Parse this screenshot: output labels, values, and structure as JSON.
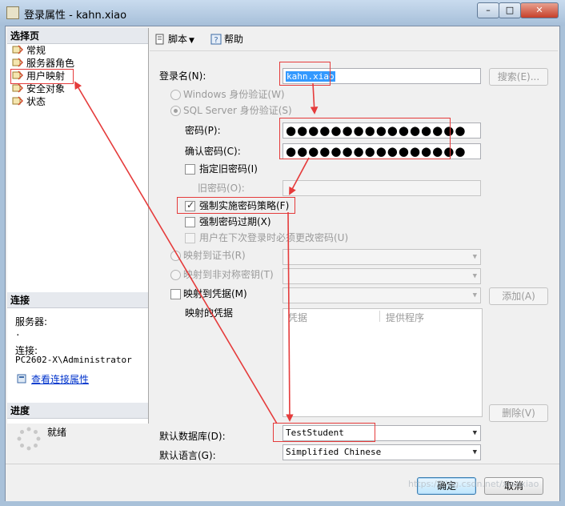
{
  "window": {
    "title": "登录属性 - kahn.xiao"
  },
  "left": {
    "pages_header": "选择页",
    "pages": [
      "常规",
      "服务器角色",
      "用户映射",
      "安全对象",
      "状态"
    ],
    "connection_header": "连接",
    "server_label": "服务器:",
    "server_value": ".",
    "connection_label": "连接:",
    "connection_value": "PC2602-X\\Administrator",
    "view_link": "查看连接属性",
    "progress_header": "进度",
    "progress_status": "就绪"
  },
  "toolbar": {
    "script_label": "脚本",
    "help_label": "帮助"
  },
  "form": {
    "login_name_label": "登录名(N):",
    "login_name_value": "kahn.xiao",
    "search_button": "搜索(E)...",
    "windows_auth": "Windows 身份验证(W)",
    "sql_auth": "SQL Server 身份验证(S)",
    "password_label": "密码(P):",
    "password_value": "●●●●●●●●●●●●●●●●",
    "confirm_label": "确认密码(C):",
    "confirm_value": "●●●●●●●●●●●●●●●●",
    "specify_old": "指定旧密码(I)",
    "old_password_label": "旧密码(O):",
    "enforce_policy": "强制实施密码策略(F)",
    "enforce_expiration": "强制密码过期(X)",
    "must_change": "用户在下次登录时必须更改密码(U)",
    "map_cert": "映射到证书(R)",
    "map_asym": "映射到非对称密钥(T)",
    "map_cred": "映射到凭据(M)",
    "add_button": "添加(A)",
    "mapped_creds_label": "映射的凭据",
    "grid_col_cred": "凭据",
    "grid_col_provider": "提供程序",
    "delete_button": "删除(V)",
    "default_db_label": "默认数据库(D):",
    "default_db_value": "TestStudent",
    "default_lang_label": "默认语言(G):",
    "default_lang_value": "Simplified Chinese"
  },
  "buttons": {
    "ok": "确定",
    "cancel": "取消"
  },
  "watermark": "https://blog.csdn.net/xiaoxiao"
}
